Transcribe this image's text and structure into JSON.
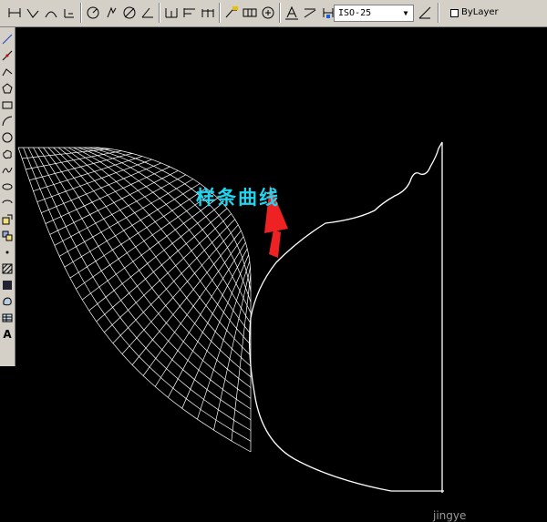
{
  "toolbar": {
    "dim_style_value": "ISO-25",
    "layer_value": "ByLayer"
  },
  "left_toolbar": {
    "text_tool_label": "A"
  },
  "canvas": {
    "annotation": "样条曲线",
    "watermark": "jingye"
  },
  "colors": {
    "annotation": "#22d4ee",
    "arrow": "#ee2222",
    "linework": "#ffffff"
  }
}
